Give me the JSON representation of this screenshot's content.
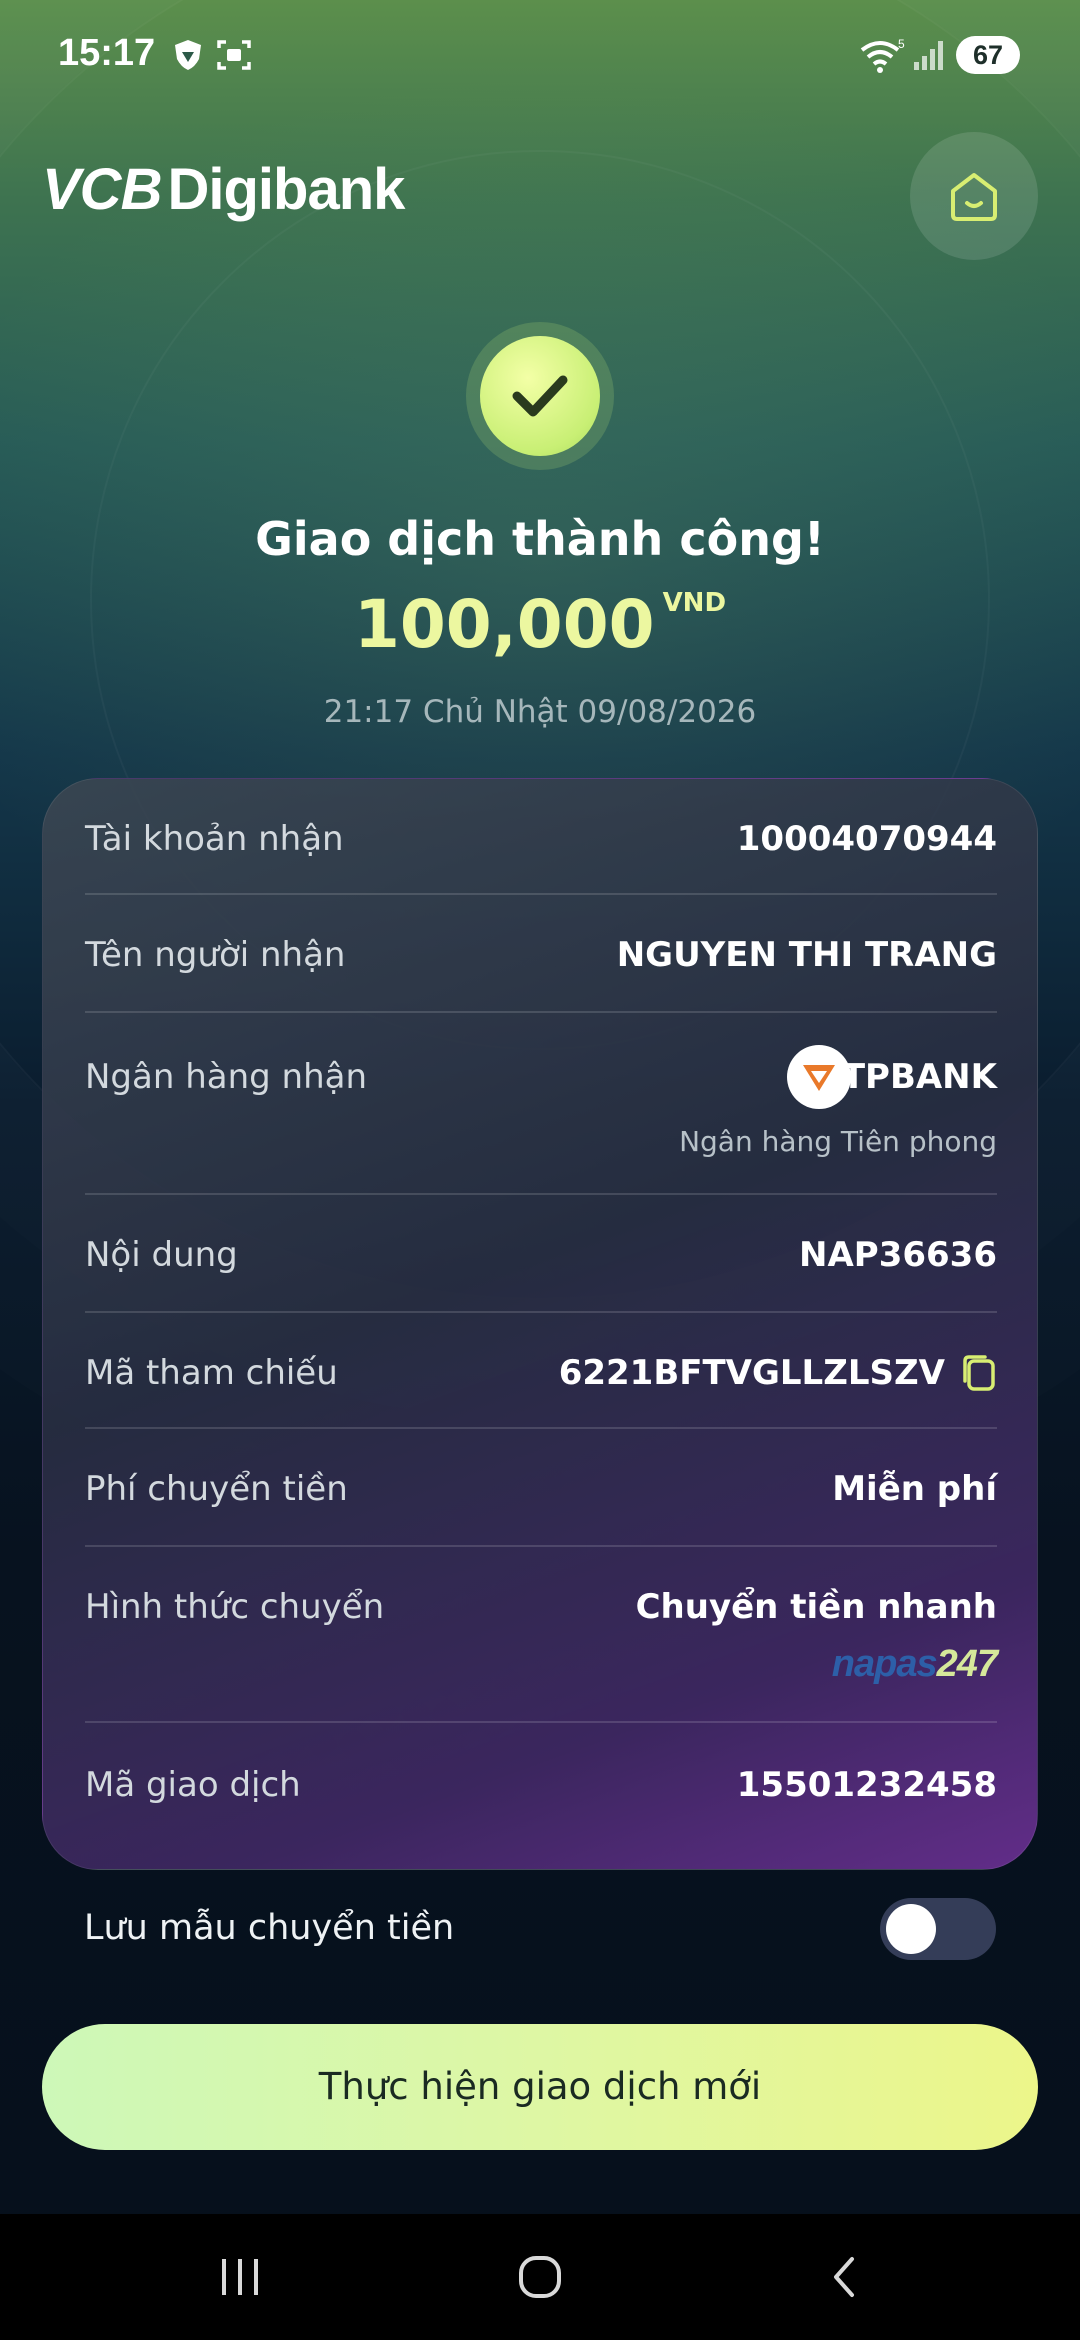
{
  "status_bar": {
    "time": "15:17",
    "battery": "67",
    "icons": [
      "shield-icon",
      "screen-record-icon",
      "wifi-icon",
      "signal-icon"
    ]
  },
  "header": {
    "logo_prefix": "VCB",
    "logo_suffix": "Digibank",
    "home_icon": "home-face-icon"
  },
  "result": {
    "icon": "checkmark-icon",
    "title": "Giao dịch thành công!",
    "amount": "100,000",
    "currency": "VND",
    "datetime": "21:17 Chủ Nhật 09/08/2026"
  },
  "details": {
    "rows": [
      {
        "label": "Tài khoản nhận",
        "value": "10004070944"
      },
      {
        "label": "Tên người nhận",
        "value": "NGUYEN THI TRANG"
      },
      {
        "label": "Ngân hàng nhận",
        "value": "TPBANK",
        "sub": "Ngân hàng Tiên phong"
      },
      {
        "label": "Nội dung",
        "value": "NAP36636"
      },
      {
        "label": "Mã tham chiếu",
        "value": "6221BFTVGLLZLSZV"
      },
      {
        "label": "Phí chuyển tiền",
        "value": "Miễn phí"
      },
      {
        "label": "Hình thức chuyển",
        "value": "Chuyển tiền nhanh",
        "brand_part1": "napas",
        "brand_part2": "247"
      },
      {
        "label": "Mã giao dịch",
        "value": "15501232458"
      }
    ]
  },
  "save_template": {
    "label": "Lưu mẫu chuyển tiền",
    "enabled": false
  },
  "primary_action": {
    "label": "Thực hiện giao dịch mới"
  },
  "colors": {
    "accent": "#ecf7a0",
    "button_gradient_start": "#cdf8b8",
    "button_gradient_end": "#ecf68a"
  }
}
